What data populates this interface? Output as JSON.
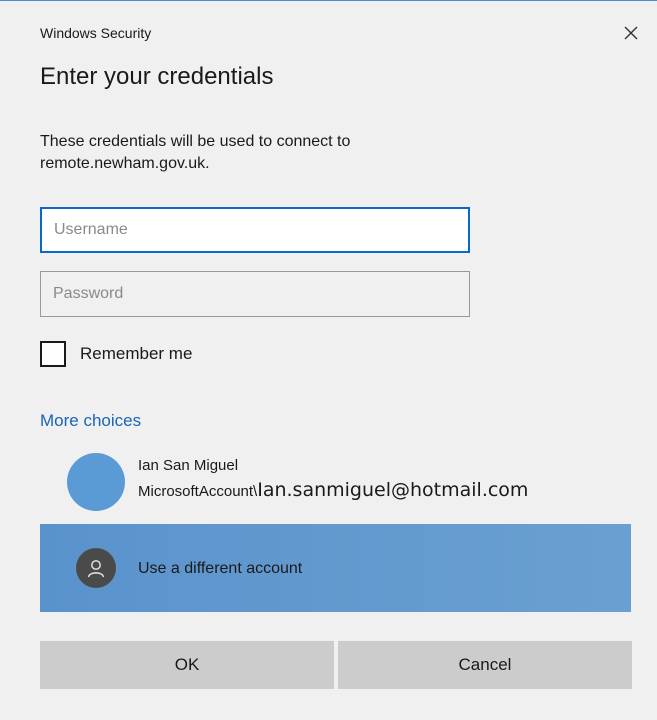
{
  "window": {
    "title": "Windows Security"
  },
  "dialog": {
    "heading": "Enter your credentials",
    "description": "These credentials will be used to connect to remote.newham.gov.uk."
  },
  "fields": {
    "username": {
      "value": "",
      "placeholder": "Username"
    },
    "password": {
      "value": "",
      "placeholder": "Password"
    }
  },
  "remember": {
    "label": "Remember me",
    "checked": false
  },
  "more_choices": {
    "label": "More choices"
  },
  "accounts": [
    {
      "name": "Ian San Miguel",
      "prefix": "MicrosoftAccount\\",
      "email": "Ian.sanmiguel@hotmail.com",
      "icon": "avatar-circle"
    },
    {
      "label": "Use a different account",
      "icon": "person-icon",
      "selected": true
    }
  ],
  "buttons": {
    "ok": "OK",
    "cancel": "Cancel"
  },
  "colors": {
    "accent": "#0a68c8",
    "link": "#1a64b8",
    "selected_bg": "#5a93cc",
    "button_bg": "#cccccc",
    "dialog_bg": "#f0f0f0"
  }
}
